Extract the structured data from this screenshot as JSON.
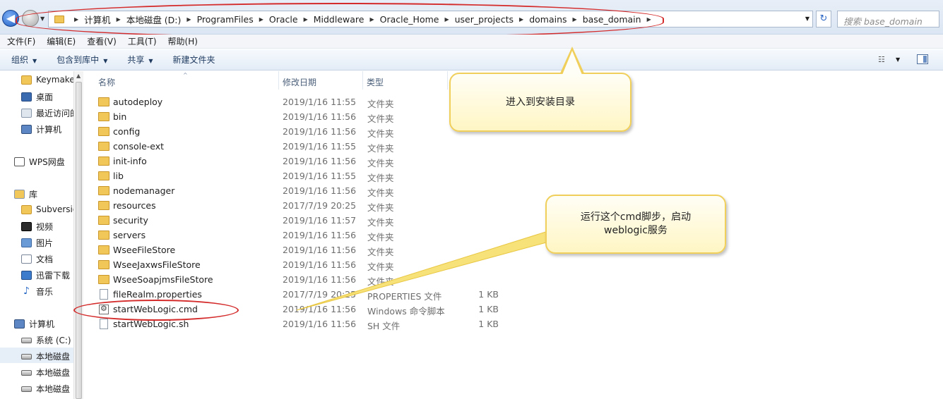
{
  "breadcrumb": [
    "计算机",
    "本地磁盘 (D:)",
    "ProgramFiles",
    "Oracle",
    "Middleware",
    "Oracle_Home",
    "user_projects",
    "domains",
    "base_domain"
  ],
  "search": {
    "placeholder": "搜索 base_domain"
  },
  "menu": [
    "文件(F)",
    "编辑(E)",
    "查看(V)",
    "工具(T)",
    "帮助(H)"
  ],
  "toolbar": {
    "organize": "组织",
    "include": "包含到库中",
    "share": "共享",
    "new_folder": "新建文件夹"
  },
  "nav": {
    "items": [
      {
        "label": "Keymake",
        "icon": "folder-icon"
      },
      {
        "label": "桌面",
        "icon": "desktop-icon"
      },
      {
        "label": "最近访问的",
        "icon": "recent-icon"
      },
      {
        "label": "计算机",
        "icon": "computer-icon"
      },
      {
        "label": "WPS网盘",
        "icon": "wps-icon"
      },
      {
        "label": "库",
        "icon": "library-icon"
      },
      {
        "label": "Subversion",
        "icon": "folder-icon"
      },
      {
        "label": "视频",
        "icon": "video-icon"
      },
      {
        "label": "图片",
        "icon": "image-icon"
      },
      {
        "label": "文档",
        "icon": "document-icon"
      },
      {
        "label": "迅雷下载",
        "icon": "thunder-icon"
      },
      {
        "label": "音乐",
        "icon": "music-icon"
      },
      {
        "label": "计算机",
        "icon": "computer-icon"
      },
      {
        "label": "系统 (C:)",
        "icon": "drive-icon"
      },
      {
        "label": "本地磁盘",
        "icon": "drive-icon"
      },
      {
        "label": "本地磁盘",
        "icon": "drive-icon"
      },
      {
        "label": "本地磁盘",
        "icon": "drive-icon"
      }
    ]
  },
  "columns": {
    "name": "名称",
    "date": "修改日期",
    "type": "类型"
  },
  "files": [
    {
      "name": "autodeploy",
      "date": "2019/1/16 11:55",
      "type": "文件夹",
      "size": "",
      "kind": "folder"
    },
    {
      "name": "bin",
      "date": "2019/1/16 11:56",
      "type": "文件夹",
      "size": "",
      "kind": "folder"
    },
    {
      "name": "config",
      "date": "2019/1/16 11:56",
      "type": "文件夹",
      "size": "",
      "kind": "folder"
    },
    {
      "name": "console-ext",
      "date": "2019/1/16 11:55",
      "type": "文件夹",
      "size": "",
      "kind": "folder"
    },
    {
      "name": "init-info",
      "date": "2019/1/16 11:56",
      "type": "文件夹",
      "size": "",
      "kind": "folder"
    },
    {
      "name": "lib",
      "date": "2019/1/16 11:55",
      "type": "文件夹",
      "size": "",
      "kind": "folder"
    },
    {
      "name": "nodemanager",
      "date": "2019/1/16 11:56",
      "type": "文件夹",
      "size": "",
      "kind": "folder"
    },
    {
      "name": "resources",
      "date": "2017/7/19 20:25",
      "type": "文件夹",
      "size": "",
      "kind": "folder"
    },
    {
      "name": "security",
      "date": "2019/1/16 11:57",
      "type": "文件夹",
      "size": "",
      "kind": "folder"
    },
    {
      "name": "servers",
      "date": "2019/1/16 11:56",
      "type": "文件夹",
      "size": "",
      "kind": "folder"
    },
    {
      "name": "WseeFileStore",
      "date": "2019/1/16 11:56",
      "type": "文件夹",
      "size": "",
      "kind": "folder"
    },
    {
      "name": "WseeJaxwsFileStore",
      "date": "2019/1/16 11:56",
      "type": "文件夹",
      "size": "",
      "kind": "folder"
    },
    {
      "name": "WseeSoapjmsFileStore",
      "date": "2019/1/16 11:56",
      "type": "文件夹",
      "size": "",
      "kind": "folder"
    },
    {
      "name": "fileRealm.properties",
      "date": "2017/7/19 20:25",
      "type": "PROPERTIES 文件",
      "size": "1 KB",
      "kind": "file"
    },
    {
      "name": "startWebLogic.cmd",
      "date": "2019/1/16 11:56",
      "type": "Windows 命令脚本",
      "size": "1 KB",
      "kind": "cmd"
    },
    {
      "name": "startWebLogic.sh",
      "date": "2019/1/16 11:56",
      "type": "SH 文件",
      "size": "1 KB",
      "kind": "file"
    }
  ],
  "callouts": {
    "enter_dir": "进入到安装目录",
    "run_cmd_line1": "运行这个cmd脚步，启动",
    "run_cmd_line2": "weblogic服务"
  },
  "colors": {
    "annotation_red": "#d42b2b",
    "callout_border": "#f0cf5b",
    "folder": "#f2c759"
  }
}
